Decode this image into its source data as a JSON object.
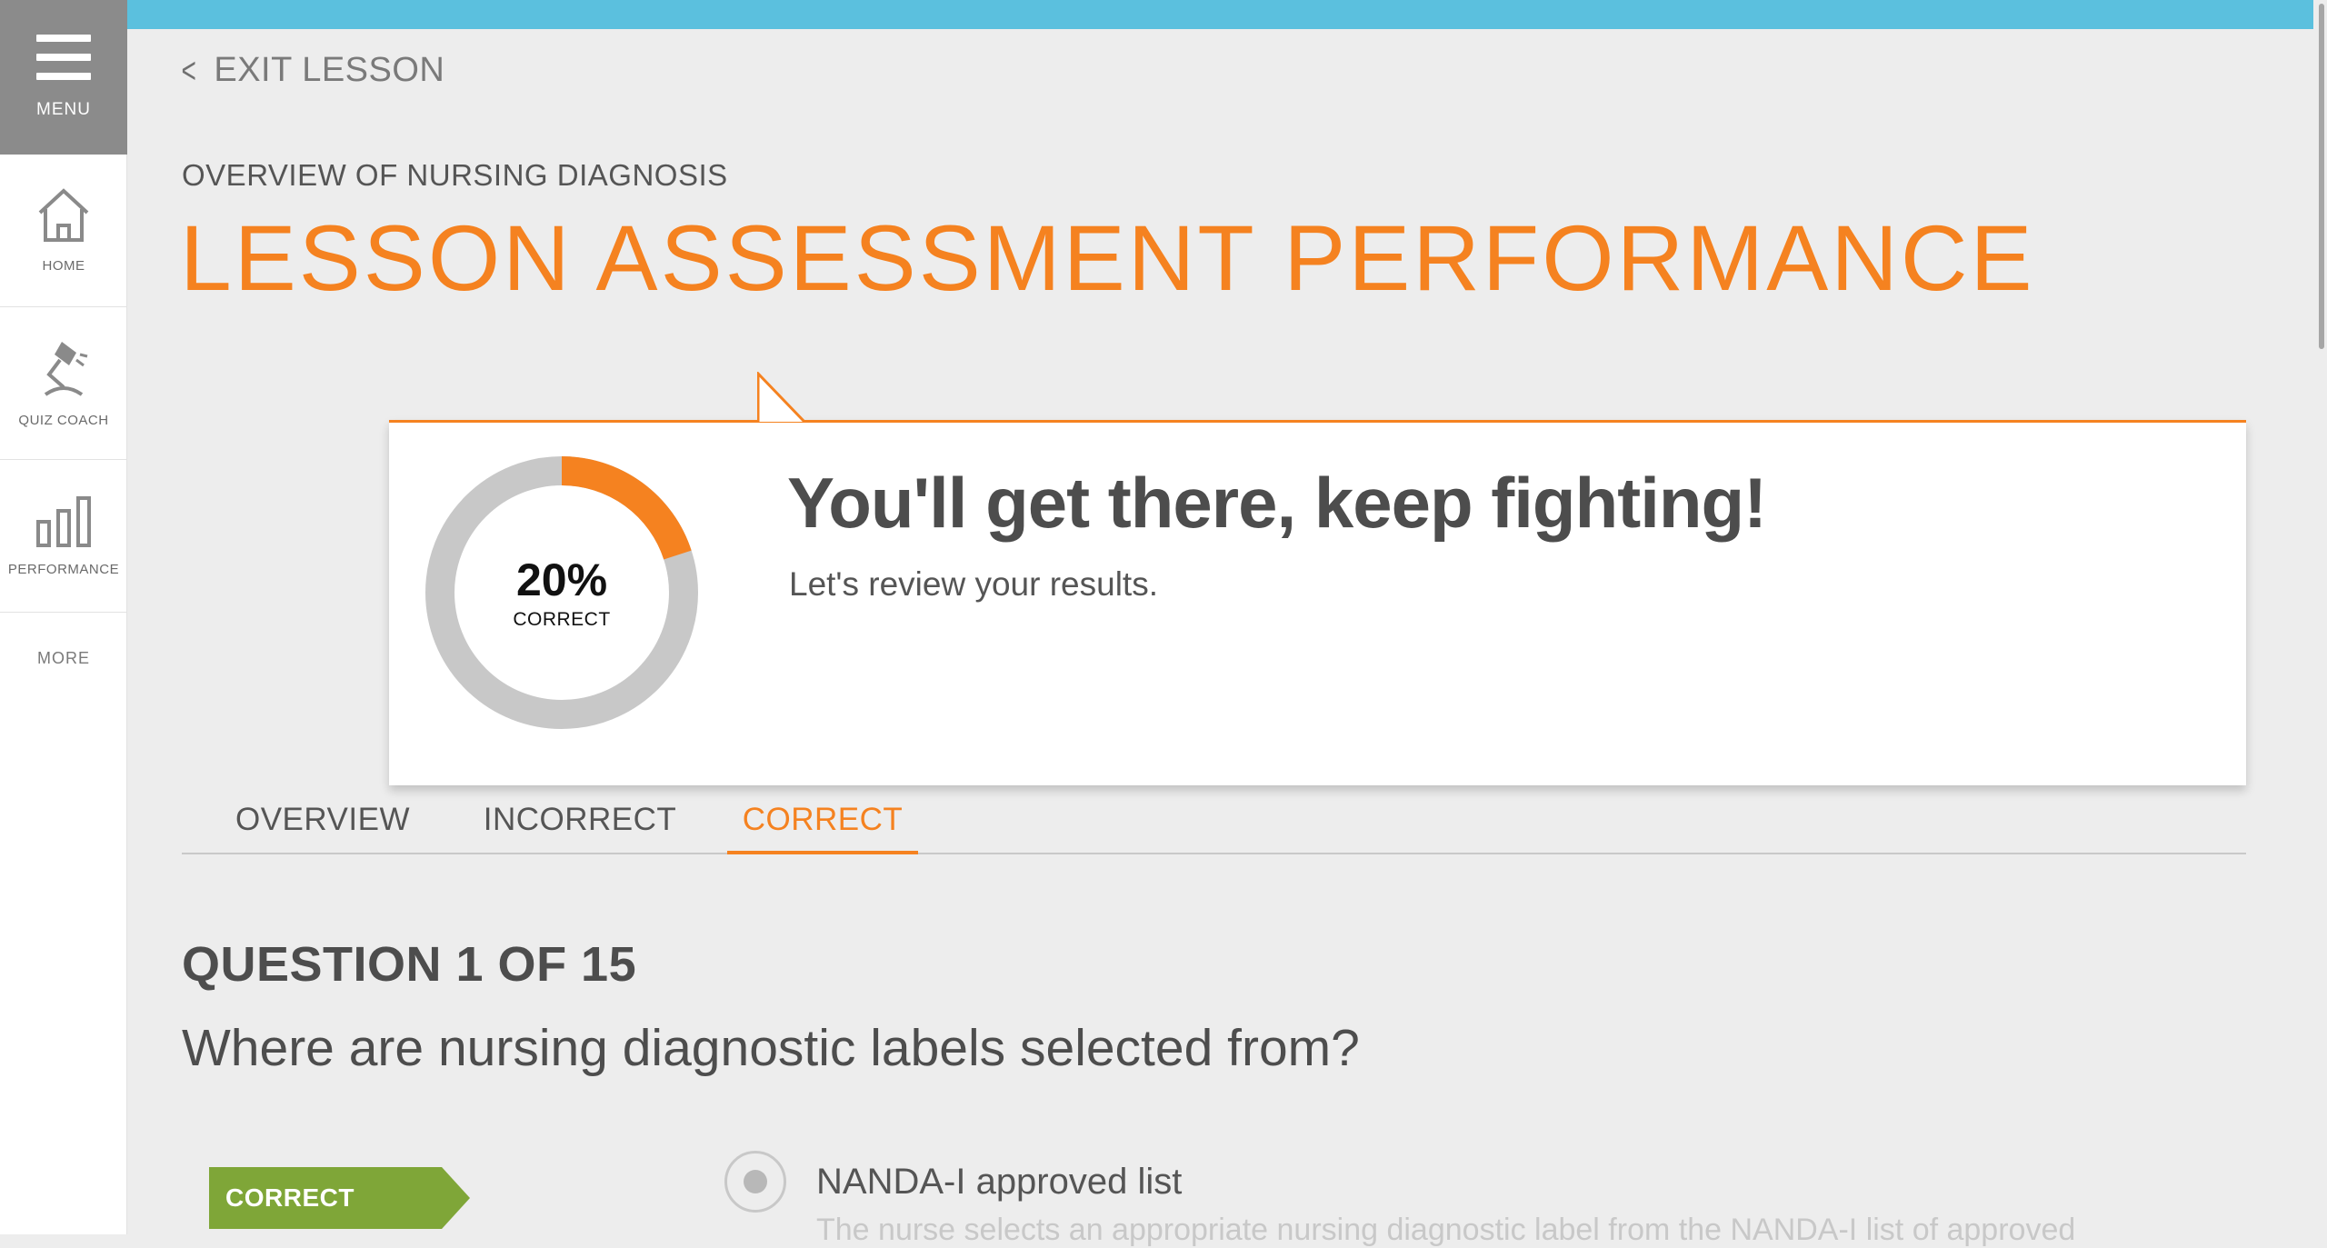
{
  "sidebar": {
    "menu_label": "MENU",
    "items": [
      {
        "label": "HOME",
        "icon": "home-icon"
      },
      {
        "label": "QUIZ COACH",
        "icon": "lamp-icon"
      },
      {
        "label": "PERFORMANCE",
        "icon": "bar-chart-icon"
      }
    ],
    "more_label": "MORE"
  },
  "header": {
    "exit_label": "EXIT LESSON",
    "subtitle": "OVERVIEW OF NURSING DIAGNOSIS",
    "title": "LESSON ASSESSMENT PERFORMANCE"
  },
  "result": {
    "percent_text": "20%",
    "percent_value": 20,
    "percent_label": "CORRECT",
    "headline": "You'll get there, keep fighting!",
    "subline": "Let's review your results.",
    "colors": {
      "accent": "#f58220",
      "track": "#c8c8c8"
    }
  },
  "tabs": [
    {
      "label": "OVERVIEW",
      "active": false
    },
    {
      "label": "INCORRECT",
      "active": false
    },
    {
      "label": "CORRECT",
      "active": true
    }
  ],
  "question": {
    "number_label": "QUESTION 1 OF 15",
    "text": "Where are nursing diagnostic labels selected from?",
    "badge": "CORRECT",
    "answer": "NANDA-I approved list",
    "rationale": "The nurse selects an appropriate nursing diagnostic label from the NANDA-I list of approved"
  },
  "colors": {
    "topbar": "#5bc0de",
    "menu_bg": "#8b8b8b",
    "correct_badge": "#7fa638"
  }
}
